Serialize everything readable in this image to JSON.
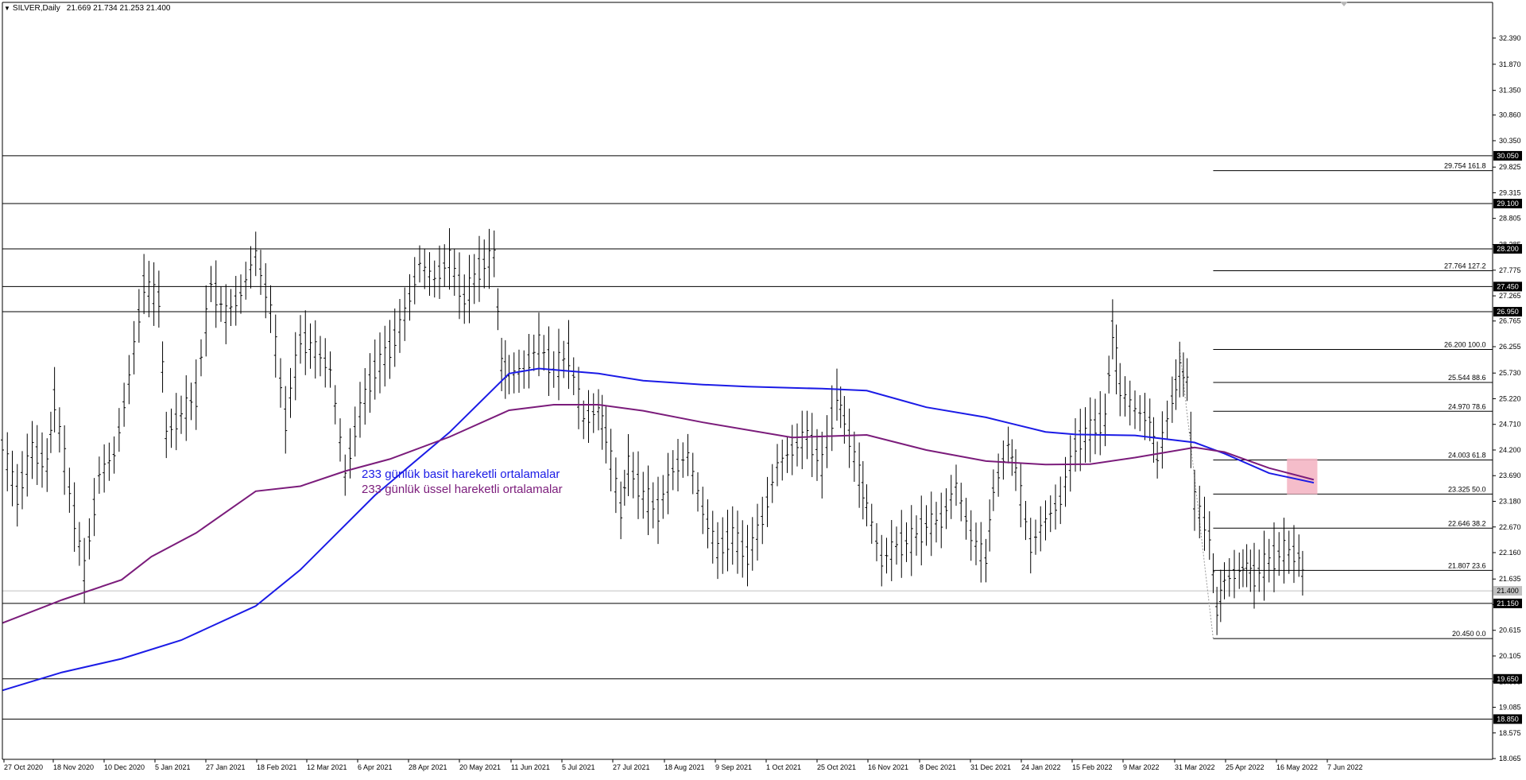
{
  "header": {
    "symbol": "SILVER,Daily",
    "ohlc": "21.669 21.734 21.253 21.400"
  },
  "chart_data": {
    "type": "line",
    "price_axis": {
      "ylim": [
        18.05,
        33.1
      ],
      "ticks": [
        "32.390",
        "31.870",
        "31.350",
        "30.860",
        "30.350",
        "29.825",
        "29.315",
        "28.805",
        "28.285",
        "27.775",
        "27.265",
        "26.765",
        "26.255",
        "25.730",
        "25.220",
        "24.710",
        "24.200",
        "23.690",
        "23.180",
        "22.670",
        "22.160",
        "21.635",
        "21.125",
        "20.615",
        "20.105",
        "19.595",
        "19.085",
        "18.575",
        "18.065"
      ]
    },
    "time_axis": {
      "labels": [
        "27 Oct 2020",
        "18 Nov 2020",
        "10 Dec 2020",
        "5 Jan 2021",
        "27 Jan 2021",
        "18 Feb 2021",
        "12 Mar 2021",
        "6 Apr 2021",
        "28 Apr 2021",
        "20 May 2021",
        "11 Jun 2021",
        "5 Jul 2021",
        "27 Jul 2021",
        "18 Aug 2021",
        "9 Sep 2021",
        "1 Oct 2021",
        "25 Oct 2021",
        "16 Nov 2021",
        "8 Dec 2021",
        "31 Dec 2021",
        "24 Jan 2022",
        "15 Feb 2022",
        "9 Mar 2022",
        "31 Mar 2022",
        "25 Apr 2022",
        "16 May 2022",
        "7 Jun 2022"
      ]
    },
    "horizontal_levels": [
      {
        "label": "30.050",
        "value": 30.05
      },
      {
        "label": "29.100",
        "value": 29.1
      },
      {
        "label": "28.200",
        "value": 28.2
      },
      {
        "label": "27.450",
        "value": 27.45
      },
      {
        "label": "26.950",
        "value": 26.95
      },
      {
        "label": "21.150",
        "value": 21.15
      },
      {
        "label": "19.650",
        "value": 19.65
      },
      {
        "label": "18.850",
        "value": 18.85
      }
    ],
    "current_price": {
      "label": "21.400",
      "value": 21.4,
      "color": "#c0c0c0"
    },
    "fibonacci": [
      {
        "text": "29.754 161.8",
        "value": 29.754
      },
      {
        "text": "27.764 127.2",
        "value": 27.764
      },
      {
        "text": "26.200 100.0",
        "value": 26.2
      },
      {
        "text": "25.544 88.6",
        "value": 25.544
      },
      {
        "text": "24.970 78.6",
        "value": 24.97
      },
      {
        "text": "24.003 61.8",
        "value": 24.003
      },
      {
        "text": "23.325 50.0",
        "value": 23.325
      },
      {
        "text": "22.646 38.2",
        "value": 22.646
      },
      {
        "text": "21.807 23.6",
        "value": 21.807
      },
      {
        "text": "20.450 0.0",
        "value": 20.45
      }
    ],
    "series": [
      {
        "name": "233 günlük basit hareketli ortalamalar",
        "color": "#1b1be6",
        "points": [
          [
            0,
            19.42
          ],
          [
            0.04,
            19.78
          ],
          [
            0.08,
            20.05
          ],
          [
            0.12,
            20.42
          ],
          [
            0.17,
            21.1
          ],
          [
            0.2,
            21.82
          ],
          [
            0.25,
            23.3
          ],
          [
            0.3,
            24.55
          ],
          [
            0.34,
            25.72
          ],
          [
            0.36,
            25.82
          ],
          [
            0.4,
            25.72
          ],
          [
            0.43,
            25.58
          ],
          [
            0.47,
            25.5
          ],
          [
            0.5,
            25.46
          ],
          [
            0.55,
            25.42
          ],
          [
            0.58,
            25.38
          ],
          [
            0.62,
            25.05
          ],
          [
            0.66,
            24.85
          ],
          [
            0.7,
            24.56
          ],
          [
            0.72,
            24.51
          ],
          [
            0.76,
            24.49
          ],
          [
            0.8,
            24.35
          ],
          [
            0.82,
            24.13
          ],
          [
            0.85,
            23.74
          ],
          [
            0.88,
            23.55
          ]
        ]
      },
      {
        "name": "233 günlük üssel hareketli ortalamalar",
        "color": "#7b1c7b",
        "points": [
          [
            0,
            20.76
          ],
          [
            0.04,
            21.22
          ],
          [
            0.08,
            21.62
          ],
          [
            0.1,
            22.08
          ],
          [
            0.13,
            22.55
          ],
          [
            0.17,
            23.38
          ],
          [
            0.2,
            23.48
          ],
          [
            0.23,
            23.78
          ],
          [
            0.26,
            24.02
          ],
          [
            0.3,
            24.46
          ],
          [
            0.34,
            24.99
          ],
          [
            0.37,
            25.1
          ],
          [
            0.4,
            25.1
          ],
          [
            0.43,
            24.98
          ],
          [
            0.47,
            24.75
          ],
          [
            0.53,
            24.45
          ],
          [
            0.58,
            24.5
          ],
          [
            0.62,
            24.2
          ],
          [
            0.66,
            23.98
          ],
          [
            0.7,
            23.91
          ],
          [
            0.73,
            23.92
          ],
          [
            0.76,
            24.05
          ],
          [
            0.8,
            24.25
          ],
          [
            0.82,
            24.16
          ],
          [
            0.85,
            23.84
          ],
          [
            0.88,
            23.61
          ]
        ]
      }
    ],
    "annotations": [
      {
        "text": "233 günlük basit hareketli ortalamalar",
        "color": "#1b1be6"
      },
      {
        "text": "233 günlük üssel hareketli ortalamalar",
        "color": "#7b1c7b"
      }
    ],
    "highlight_box": {
      "color": "#f4b6c4",
      "y_range": [
        23.32,
        24.03
      ]
    },
    "ohlc_path": [
      [
        0,
        24.3
      ],
      [
        0.01,
        23.3
      ],
      [
        0.02,
        24.2
      ],
      [
        0.03,
        23.9
      ],
      [
        0.035,
        25.2
      ],
      [
        0.045,
        23.4
      ],
      [
        0.055,
        21.8
      ],
      [
        0.065,
        23.7
      ],
      [
        0.075,
        24.1
      ],
      [
        0.085,
        25.6
      ],
      [
        0.095,
        27.5
      ],
      [
        0.105,
        27.2
      ],
      [
        0.11,
        24.5
      ],
      [
        0.12,
        24.9
      ],
      [
        0.13,
        25.3
      ],
      [
        0.14,
        27.5
      ],
      [
        0.15,
        26.9
      ],
      [
        0.16,
        27.3
      ],
      [
        0.17,
        28.1
      ],
      [
        0.18,
        27.0
      ],
      [
        0.19,
        24.8
      ],
      [
        0.2,
        26.4
      ],
      [
        0.21,
        26.2
      ],
      [
        0.22,
        25.8
      ],
      [
        0.23,
        23.7
      ],
      [
        0.24,
        25.0
      ],
      [
        0.25,
        25.8
      ],
      [
        0.26,
        26.2
      ],
      [
        0.27,
        26.9
      ],
      [
        0.28,
        27.9
      ],
      [
        0.29,
        27.6
      ],
      [
        0.3,
        28.0
      ],
      [
        0.31,
        27.2
      ],
      [
        0.32,
        27.8
      ],
      [
        0.33,
        28.1
      ],
      [
        0.335,
        25.9
      ],
      [
        0.34,
        25.7
      ],
      [
        0.35,
        25.8
      ],
      [
        0.36,
        26.3
      ],
      [
        0.37,
        25.8
      ],
      [
        0.38,
        26.1
      ],
      [
        0.39,
        24.8
      ],
      [
        0.4,
        25.0
      ],
      [
        0.405,
        24.5
      ],
      [
        0.415,
        23.0
      ],
      [
        0.42,
        23.9
      ],
      [
        0.43,
        23.3
      ],
      [
        0.44,
        23.0
      ],
      [
        0.45,
        23.8
      ],
      [
        0.46,
        24.1
      ],
      [
        0.47,
        23.0
      ],
      [
        0.48,
        22.2
      ],
      [
        0.49,
        22.5
      ],
      [
        0.5,
        22.1
      ],
      [
        0.51,
        22.8
      ],
      [
        0.52,
        23.9
      ],
      [
        0.53,
        24.2
      ],
      [
        0.54,
        24.5
      ],
      [
        0.55,
        23.9
      ],
      [
        0.56,
        25.3
      ],
      [
        0.565,
        24.8
      ],
      [
        0.575,
        23.7
      ],
      [
        0.58,
        23.1
      ],
      [
        0.59,
        22.0
      ],
      [
        0.6,
        22.3
      ],
      [
        0.61,
        22.4
      ],
      [
        0.62,
        22.7
      ],
      [
        0.63,
        22.8
      ],
      [
        0.64,
        23.5
      ],
      [
        0.65,
        22.5
      ],
      [
        0.66,
        22.0
      ],
      [
        0.665,
        23.4
      ],
      [
        0.675,
        24.3
      ],
      [
        0.68,
        23.8
      ],
      [
        0.69,
        22.3
      ],
      [
        0.7,
        22.8
      ],
      [
        0.71,
        23.2
      ],
      [
        0.72,
        24.3
      ],
      [
        0.73,
        24.6
      ],
      [
        0.74,
        24.8
      ],
      [
        0.745,
        26.6
      ],
      [
        0.75,
        25.4
      ],
      [
        0.76,
        25.0
      ],
      [
        0.77,
        24.8
      ],
      [
        0.775,
        24.0
      ],
      [
        0.785,
        25.2
      ],
      [
        0.79,
        25.8
      ],
      [
        0.795,
        25.6
      ],
      [
        0.8,
        23.2
      ],
      [
        0.81,
        22.5
      ],
      [
        0.815,
        21.0
      ],
      [
        0.82,
        21.6
      ],
      [
        0.83,
        21.8
      ],
      [
        0.835,
        21.9
      ],
      [
        0.84,
        21.7
      ],
      [
        0.85,
        22.0
      ],
      [
        0.86,
        22.2
      ],
      [
        0.87,
        22.1
      ],
      [
        0.875,
        21.4
      ]
    ]
  }
}
